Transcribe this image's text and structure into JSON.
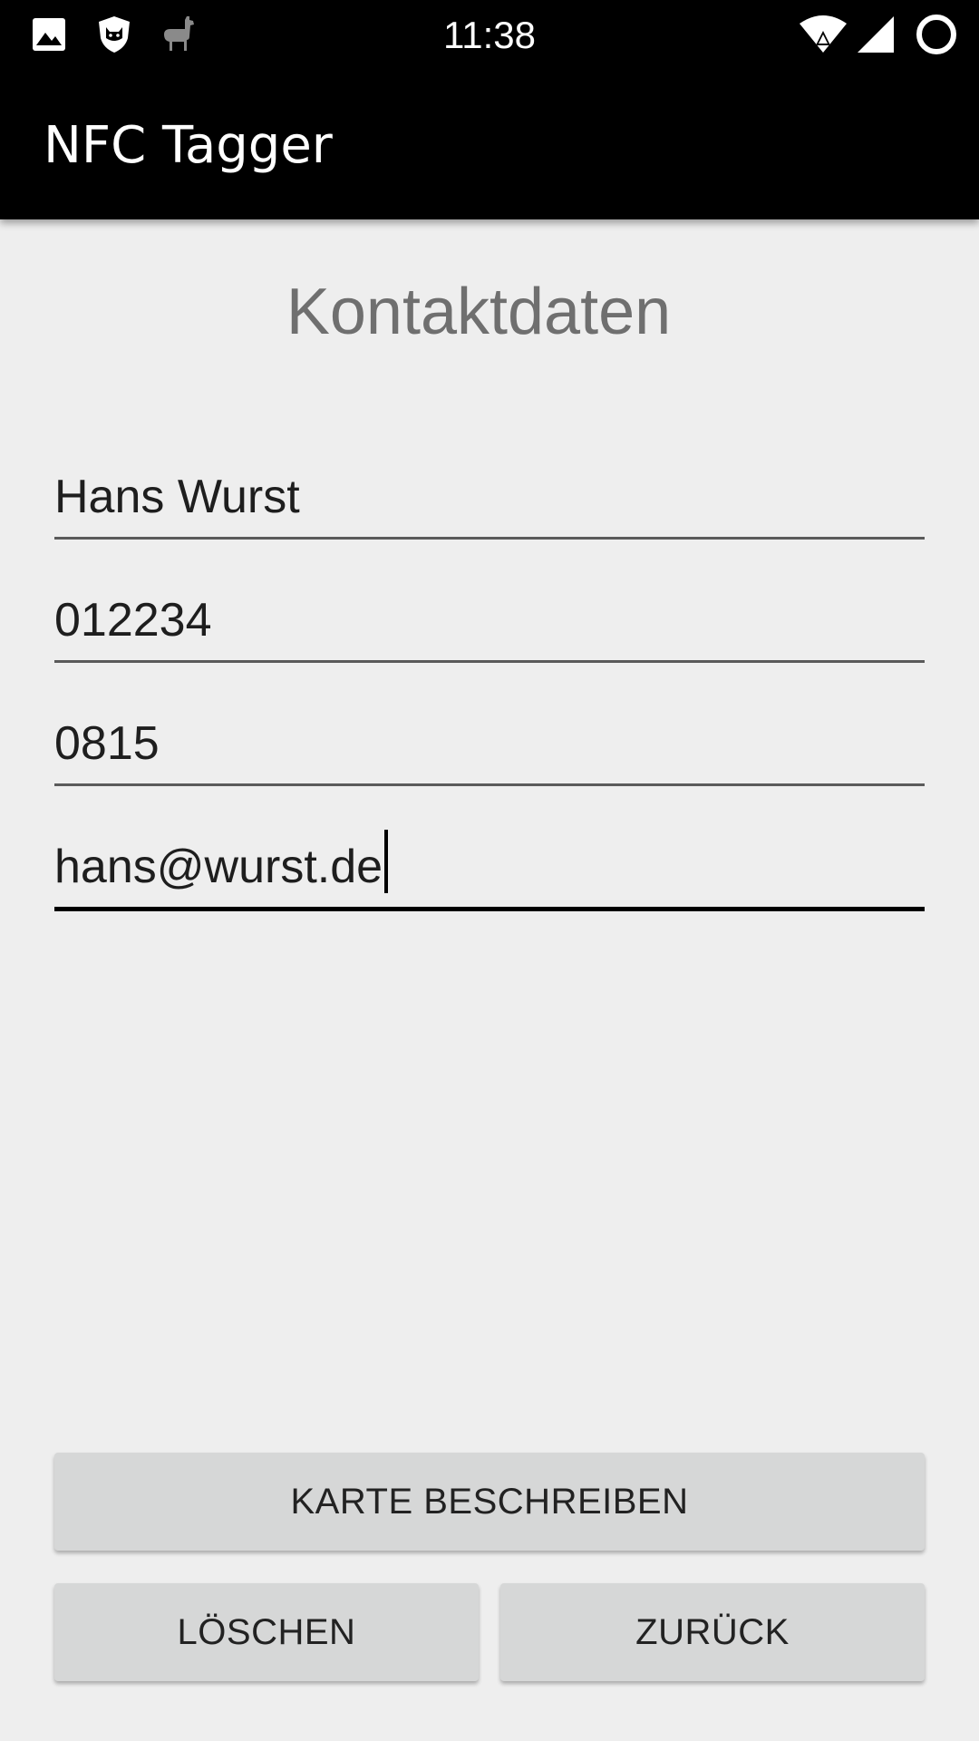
{
  "status_bar": {
    "time": "11:38",
    "icons": [
      "image-icon",
      "shield-cat-icon",
      "llama-icon",
      "wifi-icon",
      "signal-icon",
      "battery-icon"
    ]
  },
  "app_bar": {
    "title": "NFC Tagger"
  },
  "form": {
    "heading": "Kontaktdaten",
    "fields": [
      {
        "value": "Hans Wurst"
      },
      {
        "value": "012234"
      },
      {
        "value": "0815"
      },
      {
        "value": "hans@wurst.de"
      }
    ]
  },
  "buttons": {
    "write_card": "KARTE BESCHREIBEN",
    "delete": "LÖSCHEN",
    "back": "ZURÜCK"
  },
  "colors": {
    "background": "#eeeeee",
    "bars": "#000000",
    "button": "#d6d7d7",
    "heading": "#6f6f6f"
  }
}
